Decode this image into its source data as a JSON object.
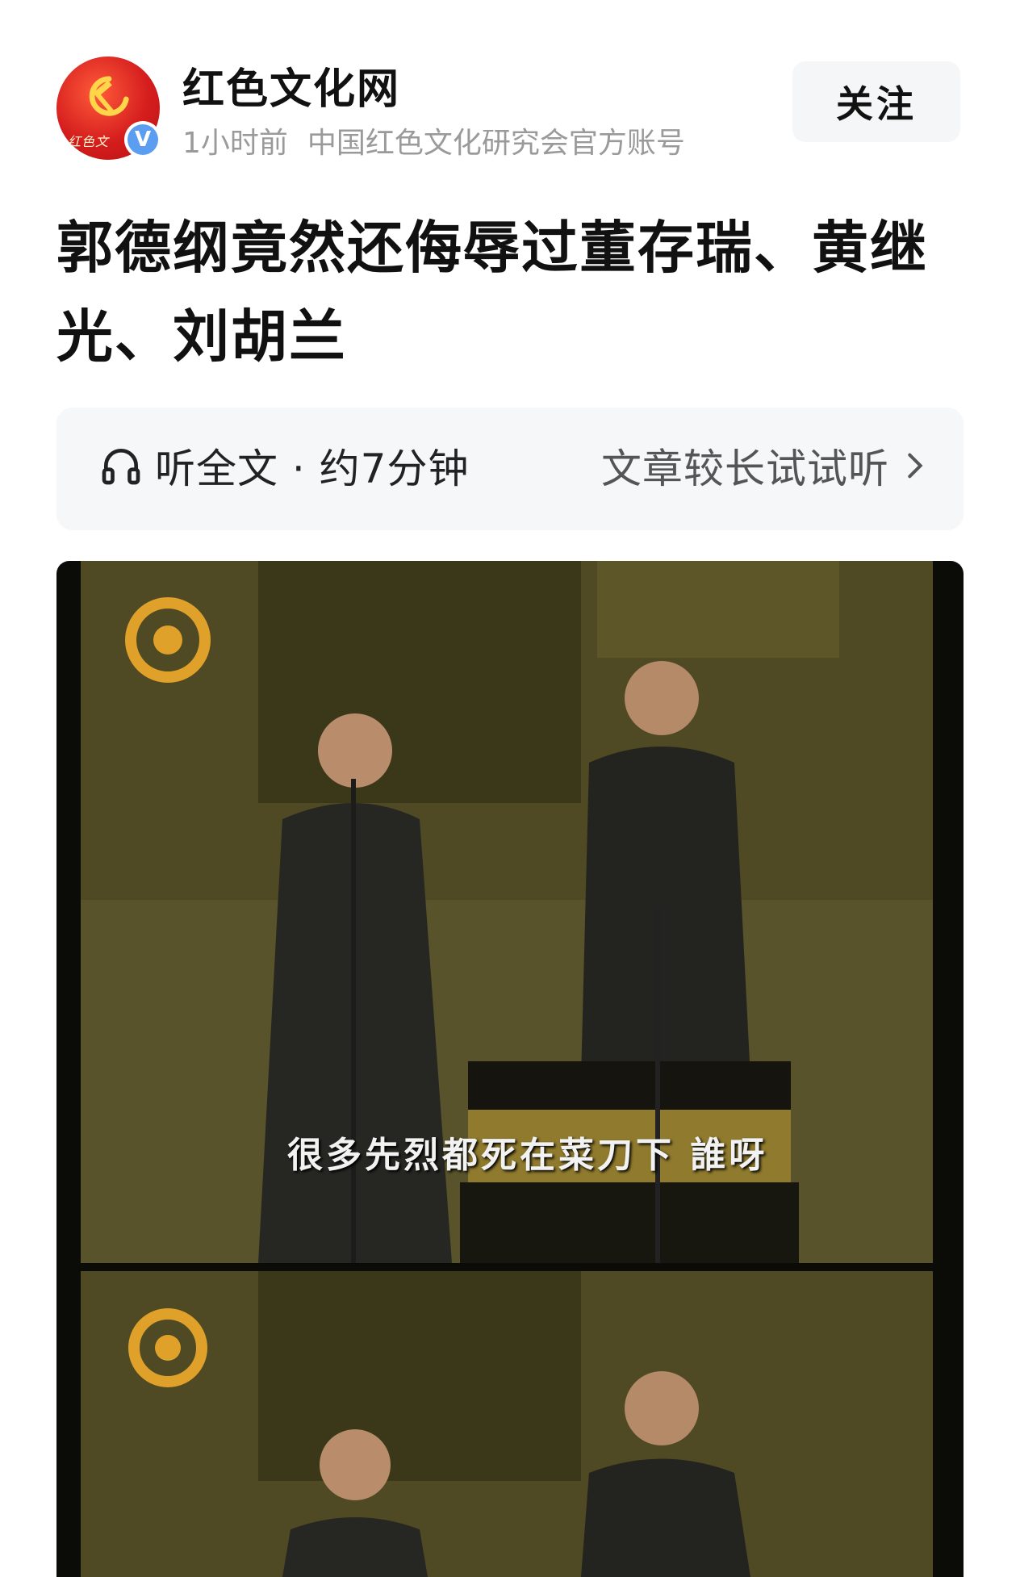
{
  "account": {
    "name": "红色文化网",
    "time_ago": "1小时前",
    "description": "中国红色文化研究会官方账号",
    "verified_mark": "V",
    "avatar_signature": "红色文",
    "follow_label": "关注"
  },
  "article": {
    "title": "郭德纲竟然还侮辱过董存瑞、黄继光、刘胡兰"
  },
  "listen_bar": {
    "label": "听全文 · 约7分钟",
    "hint": "文章较长试试听",
    "icon": "headphone-icon"
  },
  "media": {
    "subtitle": "很多先烈都死在菜刀下 誰呀"
  },
  "colors": {
    "avatar_red": "#d51e1e",
    "verified_blue": "#5b9df0",
    "muted_text": "#9a9a9a",
    "button_bg": "#f5f6f7"
  }
}
